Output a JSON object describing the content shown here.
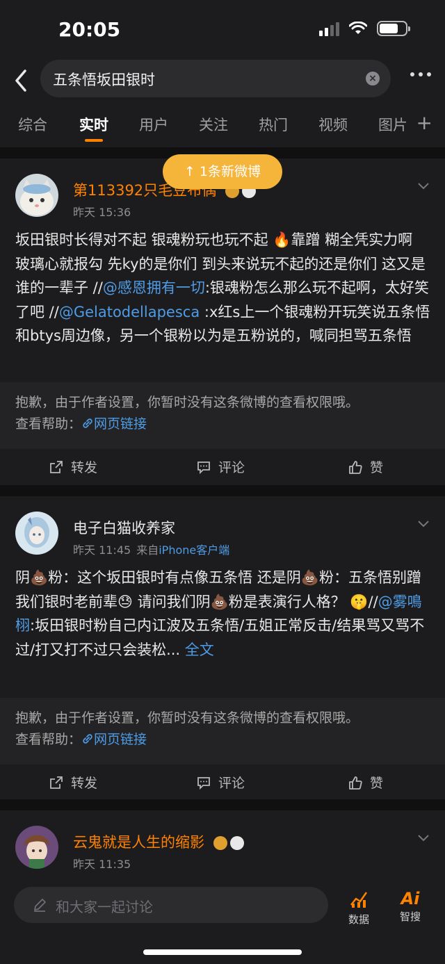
{
  "status_bar": {
    "time": "20:05"
  },
  "search": {
    "query": "五条悟坂田银时"
  },
  "tabs": [
    {
      "label": "综合"
    },
    {
      "label": "实时"
    },
    {
      "label": "用户"
    },
    {
      "label": "关注"
    },
    {
      "label": "热门"
    },
    {
      "label": "视频"
    },
    {
      "label": "图片"
    }
  ],
  "active_tab": "实时",
  "new_posts_pill": "↑ 1条新微博",
  "posts": [
    {
      "username": "第113392只毛豆布偶",
      "time": "昨天 15:36",
      "source": "",
      "text": {
        "seg1": "坂田银时长得对不起 银魂粉玩也玩不起 🔥靠蹭 糊全凭实力啊 玻璃心就报勾 先ky的是你们 到头来说玩不起的还是你们 这又是谁的一辈子 //",
        "mention1": "@感恩拥有一切",
        "seg2": ":银魂粉怎么那么玩不起啊，太好笑了吧 //",
        "mention2": "@Gelatodellapesca",
        "seg3": " :x红s上一个银魂粉开玩笑说五条悟和btys周边像，另一个银粉以为是五粉说的，喊同担骂五条悟"
      },
      "notice": "抱歉，由于作者设置，你暂时没有这条微博的查看权限哦。",
      "help_label": "查看帮助：",
      "web_link": "网页链接",
      "actions": {
        "repost": "转发",
        "comment": "评论",
        "like": "赞"
      }
    },
    {
      "username": "电子白猫收养家",
      "time": "昨天 11:45",
      "source_prefix": "来自",
      "source": "iPhone客户端",
      "text": {
        "seg1": "阴💩粉：这个坂田银时有点像五条悟 还是阴💩粉：五条悟别蹭我们银时老前辈😓 请问我们阴💩粉是表演行人格？ 🤫//",
        "mention1": "@雾鳴栩",
        "seg2": ":坂田银时粉自己内讧波及五条悟/五姐正常反击/结果骂又骂不过/打又打不过只会装松...",
        "more": " 全文"
      },
      "notice": "抱歉，由于作者设置，你暂时没有这条微博的查看权限哦。",
      "help_label": "查看帮助：",
      "web_link": "网页链接",
      "actions": {
        "repost": "转发",
        "comment": "评论",
        "like": "赞"
      }
    },
    {
      "username": "云鬼就是人生的缩影",
      "time": "昨天 11:35"
    }
  ],
  "bottom_bar": {
    "placeholder": "和大家一起讨论",
    "data_label": "数据",
    "ai_label": "智搜",
    "ai_icon_text": "Ai"
  },
  "colors": {
    "accent": "#ff8200",
    "link": "#4e9ce6",
    "pill": "#f5b43a"
  }
}
